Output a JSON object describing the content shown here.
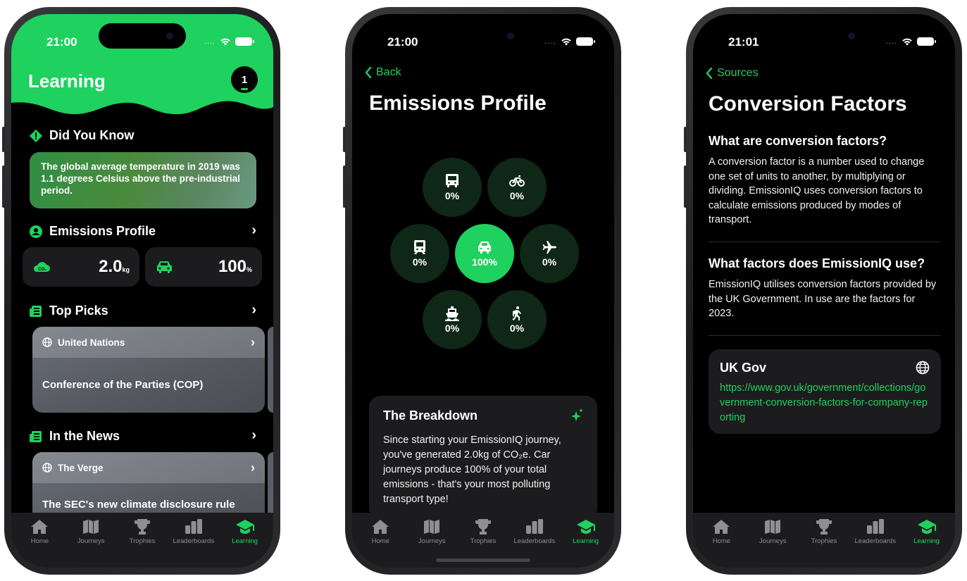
{
  "colors": {
    "accent": "#1fd15f",
    "card": "#1c1c1e",
    "background": "#000000"
  },
  "tabs": [
    {
      "label": "Home",
      "icon": "home-icon"
    },
    {
      "label": "Journeys",
      "icon": "map-icon"
    },
    {
      "label": "Trophies",
      "icon": "trophy-icon"
    },
    {
      "label": "Leaderboards",
      "icon": "leaderboard-icon"
    },
    {
      "label": "Learning",
      "icon": "graduation-cap-icon"
    }
  ],
  "phone1": {
    "time": "21:00",
    "title": "Learning",
    "badge": "1",
    "did_you_know": {
      "heading": "Did You Know",
      "text": "The global average temperature in 2019 was 1.1 degrees Celsius above the pre-industrial period."
    },
    "emissions": {
      "heading": "Emissions Profile",
      "co2_value": "2.0",
      "co2_unit": "kg",
      "car_value": "100",
      "car_unit": "%"
    },
    "top_picks": {
      "heading": "Top Picks",
      "source": "United Nations",
      "title": "Conference of the Parties (COP)"
    },
    "news": {
      "heading": "In the News",
      "source": "The Verge",
      "title": "The SEC's new climate disclosure rule already faces legal challenges"
    }
  },
  "phone2": {
    "time": "21:00",
    "back": "Back",
    "title": "Emissions Profile",
    "modes": [
      {
        "mode": "bus",
        "icon": "bus-icon",
        "value": "0%"
      },
      {
        "mode": "bicycle",
        "icon": "bicycle-icon",
        "value": "0%"
      },
      {
        "mode": "train",
        "icon": "train-icon",
        "value": "0%"
      },
      {
        "mode": "car",
        "icon": "car-icon",
        "value": "100%"
      },
      {
        "mode": "plane",
        "icon": "plane-icon",
        "value": "0%"
      },
      {
        "mode": "ferry",
        "icon": "ferry-icon",
        "value": "0%"
      },
      {
        "mode": "walking",
        "icon": "walking-icon",
        "value": "0%"
      }
    ],
    "breakdown": {
      "heading": "The Breakdown",
      "text": "Since starting your EmissionIQ journey, you've generated 2.0kg of CO₂e. Car journeys produce 100% of your total emissions - that's your most polluting transport type!"
    }
  },
  "phone3": {
    "time": "21:01",
    "back": "Sources",
    "title": "Conversion Factors",
    "q1": "What are conversion factors?",
    "a1": "A conversion factor is a number used to change one set of units to another, by multiplying or dividing. EmissionIQ uses conversion factors to calculate emissions produced by modes of transport.",
    "q2": "What factors does EmissionIQ use?",
    "a2": "EmissionIQ utilises conversion factors provided by the UK Government. In use are the factors for 2023.",
    "source": {
      "name": "UK Gov",
      "url": "https://www.gov.uk/government/collections/government-conversion-factors-for-company-reporting"
    }
  }
}
